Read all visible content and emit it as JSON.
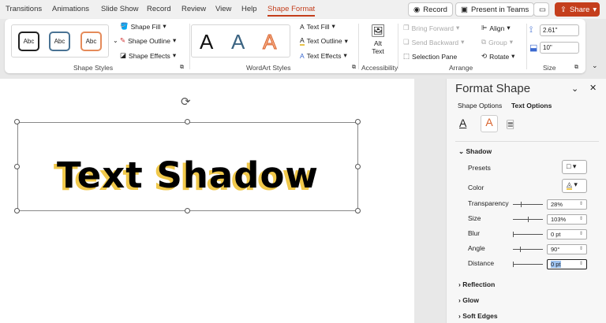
{
  "tabs": [
    "Transitions",
    "Animations",
    "Slide Show",
    "Record",
    "Review",
    "View",
    "Help",
    "Shape Format"
  ],
  "title_buttons": {
    "record": "Record",
    "teams": "Present in Teams",
    "share": "Share"
  },
  "shape_styles": {
    "previews": [
      "Abc",
      "Abc",
      "Abc"
    ],
    "fill": "Shape Fill",
    "outline": "Shape Outline",
    "effects": "Shape Effects",
    "group": "Shape Styles"
  },
  "wordart": {
    "previews": [
      "A",
      "A",
      "A"
    ],
    "fill": "Text Fill",
    "outline": "Text Outline",
    "effects": "Text Effects",
    "group": "WordArt Styles"
  },
  "accessibility": {
    "alt_text": "Alt Text",
    "group": "Accessibility"
  },
  "arrange": {
    "bring_forward": "Bring Forward",
    "send_backward": "Send Backward",
    "selection_pane": "Selection Pane",
    "align": "Align",
    "group_cmd": "Group",
    "rotate": "Rotate",
    "group": "Arrange"
  },
  "size": {
    "height": "2.61\"",
    "width": "10\"",
    "group": "Size"
  },
  "slide": {
    "text": "Text Shadow",
    "shadow_color": "#f0c84a"
  },
  "pane": {
    "title": "Format Shape",
    "tab_shape": "Shape Options",
    "tab_text": "Text Options",
    "shadow": {
      "heading": "Shadow",
      "presets": "Presets",
      "color": "Color",
      "color_value": "#f0c84a",
      "rows": [
        {
          "label": "Transparency",
          "value": "28%",
          "level": 0.28
        },
        {
          "label": "Size",
          "value": "103%",
          "level": 0.52
        },
        {
          "label": "Blur",
          "value": "0 pt",
          "level": 0
        },
        {
          "label": "Angle",
          "value": "90°",
          "level": 0.25
        },
        {
          "label": "Distance",
          "value": "0 pt",
          "level": 0
        }
      ]
    },
    "sections": [
      "Reflection",
      "Glow",
      "Soft Edges"
    ]
  }
}
